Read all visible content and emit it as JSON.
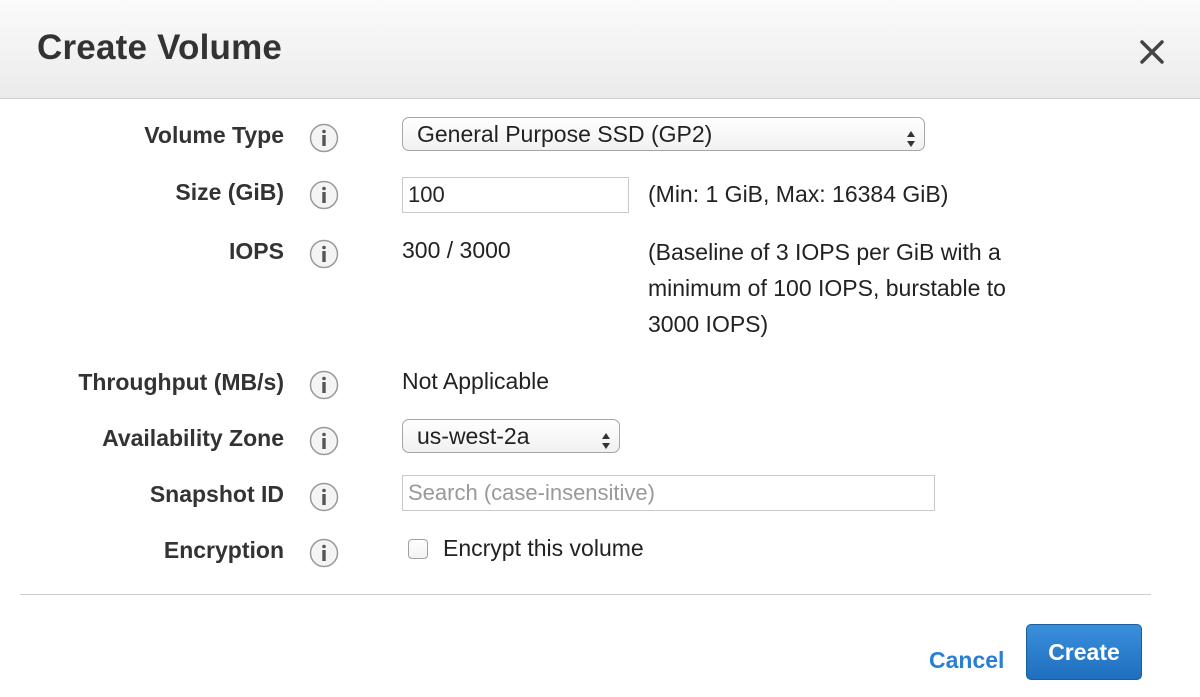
{
  "dialog": {
    "title": "Create Volume",
    "close_icon": "close-icon"
  },
  "fields": {
    "volume_type": {
      "label": "Volume Type",
      "value": "General Purpose SSD (GP2)"
    },
    "size": {
      "label": "Size (GiB)",
      "value": "100",
      "hint": "(Min: 1 GiB, Max: 16384 GiB)"
    },
    "iops": {
      "label": "IOPS",
      "value": "300 / 3000",
      "note": "(Baseline of 3 IOPS per GiB with a minimum of 100 IOPS, burstable to 3000 IOPS)"
    },
    "throughput": {
      "label": "Throughput (MB/s)",
      "value": "Not Applicable"
    },
    "availability_zone": {
      "label": "Availability Zone",
      "value": "us-west-2a"
    },
    "snapshot_id": {
      "label": "Snapshot ID",
      "placeholder": "Search (case-insensitive)",
      "value": ""
    },
    "encryption": {
      "label": "Encryption",
      "checkbox_label": "Encrypt this volume",
      "checked": false
    }
  },
  "footer": {
    "cancel_label": "Cancel",
    "create_label": "Create"
  },
  "colors": {
    "link_blue": "#2a7fd3",
    "primary_button": "#2b7fd0"
  }
}
